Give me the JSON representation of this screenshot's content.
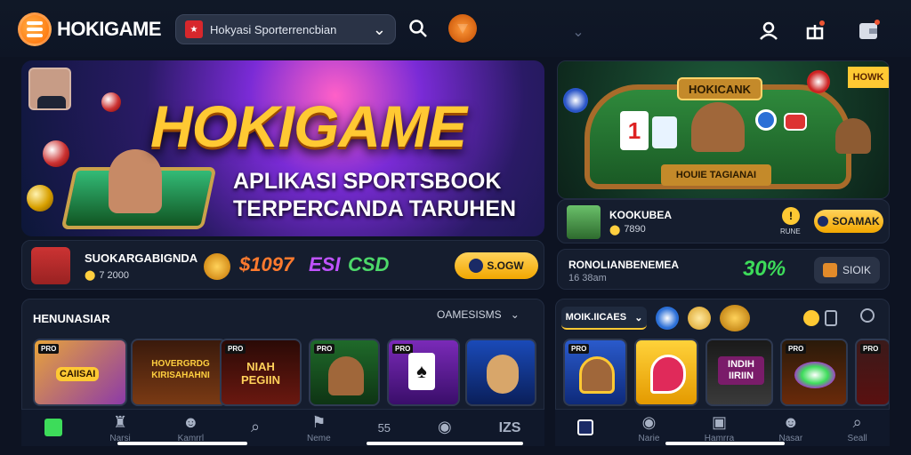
{
  "header": {
    "logo_text": "HOKIGAME",
    "search_value": "Hokyasi Sporterrencbian",
    "chevron": "⌄"
  },
  "hero": {
    "title": "HOKIGAME",
    "subtitle_line1": "APLIKASI SPORTSBOOK",
    "subtitle_line2": "TERPERCANDA TARUHEN"
  },
  "promo_row": {
    "name": "SUOKARGABIGNDA",
    "coins": "7 2000",
    "amount": "$1097",
    "badge": "ESI",
    "badge2": "CSD",
    "button_label": "S.OGW"
  },
  "right_banner": {
    "sign": "HOKICANK",
    "table_label": "HOUIE TAGIANAI",
    "tag": "HOWK"
  },
  "right_user": {
    "name": "KOOKUBEA",
    "coins": "7890",
    "mid_label": "RUNE",
    "button_label": "SOAMAK"
  },
  "right_stats": {
    "line1": "RONOLIANBENEMEA",
    "line2": "16 38am",
    "percent": "30%",
    "button_label": "SIOIK"
  },
  "left_section": {
    "title": "HENUNASIAR",
    "dropdown": "OAMESISMS",
    "games": [
      {
        "label": "CAIISAI",
        "tag": "PRO"
      },
      {
        "label": "HOVERGRDG KIRISAHAHNI",
        "tag": ""
      },
      {
        "label": "NIAH PEGIIN",
        "tag": "PRO"
      },
      {
        "label": "",
        "tag": "PRO"
      },
      {
        "label": "",
        "tag": "PRO"
      },
      {
        "label": "",
        "tag": ""
      }
    ]
  },
  "right_section": {
    "chip": "MOIK.IICAES",
    "games": [
      {
        "label": "",
        "tag": "PRO"
      },
      {
        "label": "",
        "tag": ""
      },
      {
        "label": "INDIH IIRIIN",
        "tag": ""
      },
      {
        "label": "",
        "tag": "PRO"
      },
      {
        "label": "",
        "tag": "PRO"
      }
    ]
  },
  "bottom_nav_left": [
    {
      "icon": "home-icon",
      "label": ""
    },
    {
      "icon": "trophy-icon",
      "label": "Narsi"
    },
    {
      "icon": "person-icon",
      "label": "Kamrrl"
    },
    {
      "icon": "search-icon",
      "label": ""
    },
    {
      "icon": "flag-icon",
      "label": "Neme"
    },
    {
      "icon": "text-icon",
      "label": "55"
    },
    {
      "icon": "chip-icon",
      "label": ""
    },
    {
      "icon": "grid-icon",
      "label": "IZS"
    }
  ],
  "bottom_nav_right": [
    {
      "icon": "home-icon",
      "label": ""
    },
    {
      "icon": "chip-icon",
      "label": "Narie"
    },
    {
      "icon": "tv-icon",
      "label": "Hamrra"
    },
    {
      "icon": "person-icon",
      "label": "Nasar"
    },
    {
      "icon": "search-icon",
      "label": "Seall"
    }
  ],
  "colors": {
    "accent": "#ffc933",
    "background": "#0d1322",
    "green": "#3ddc5a"
  }
}
